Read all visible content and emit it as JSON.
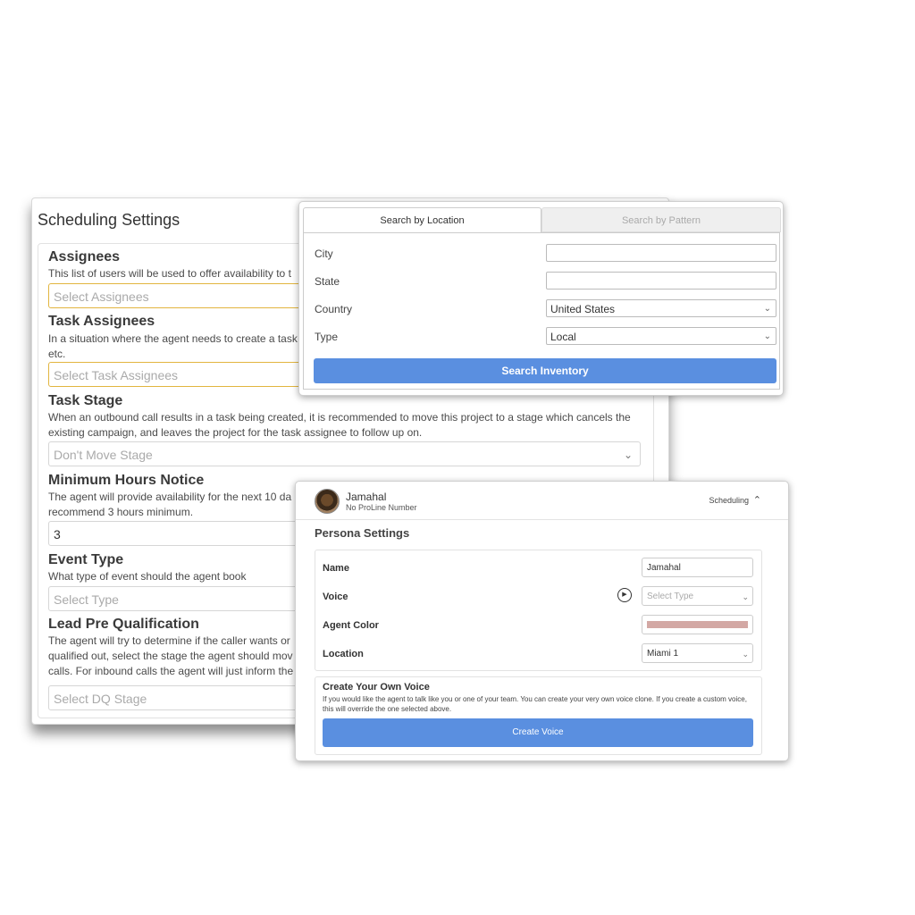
{
  "scheduling": {
    "title": "Scheduling Settings",
    "assignees": {
      "heading": "Assignees",
      "description": "This list of users will be used to offer availability to t",
      "placeholder": "Select Assignees"
    },
    "task_assignees": {
      "heading": "Task Assignees",
      "description": "In a situation where the agent needs to create a task\netc.",
      "placeholder": "Select Task Assignees"
    },
    "task_stage": {
      "heading": "Task Stage",
      "description": "When an outbound call results in a task being created, it is recommended to move this project to a stage which cancels the existing campaign, and leaves the project for the task assignee to follow up on.",
      "value": "Don't Move Stage"
    },
    "min_hours": {
      "heading": "Minimum Hours Notice",
      "description": "The agent will provide availability for the next 10 da\nrecommend 3 hours minimum.",
      "value": "3"
    },
    "event_type": {
      "heading": "Event Type",
      "description": "What type of event should the agent book",
      "placeholder": "Select Type"
    },
    "lead_pre_qual": {
      "heading": "Lead Pre Qualification",
      "description": "The agent will try to determine if the caller wants or\nqualified out, select the stage the agent should mov\ncalls. For inbound calls the agent will just inform the",
      "placeholder": "Select DQ Stage"
    }
  },
  "inventory": {
    "tabs": [
      "Search by Location",
      "Search by Pattern"
    ],
    "active_tab": "Search by Location",
    "fields": {
      "city_label": "City",
      "city_value": "",
      "state_label": "State",
      "state_value": "",
      "country_label": "Country",
      "country_value": "United States",
      "type_label": "Type",
      "type_value": "Local"
    },
    "search_button": "Search Inventory"
  },
  "persona": {
    "agent_name": "Jamahal",
    "agent_sub": "No ProLine Number",
    "header_tab": "Scheduling",
    "title": "Persona Settings",
    "name_label": "Name",
    "name_value": "Jamahal",
    "voice_label": "Voice",
    "voice_placeholder": "Select Type",
    "color_label": "Agent Color",
    "color_value": "#d3a8a4",
    "location_label": "Location",
    "location_value": "Miami 1",
    "voice_section": {
      "title": "Create Your Own Voice",
      "description": "If you would like the agent to talk like you or one of your team. You can create your very own voice clone. If you create a custom voice, this will override the one selected above.",
      "button": "Create Voice"
    }
  },
  "icons": {
    "chevron": "chevron-down-icon",
    "caret_up": "chevron-up-icon",
    "play": "play-icon"
  }
}
